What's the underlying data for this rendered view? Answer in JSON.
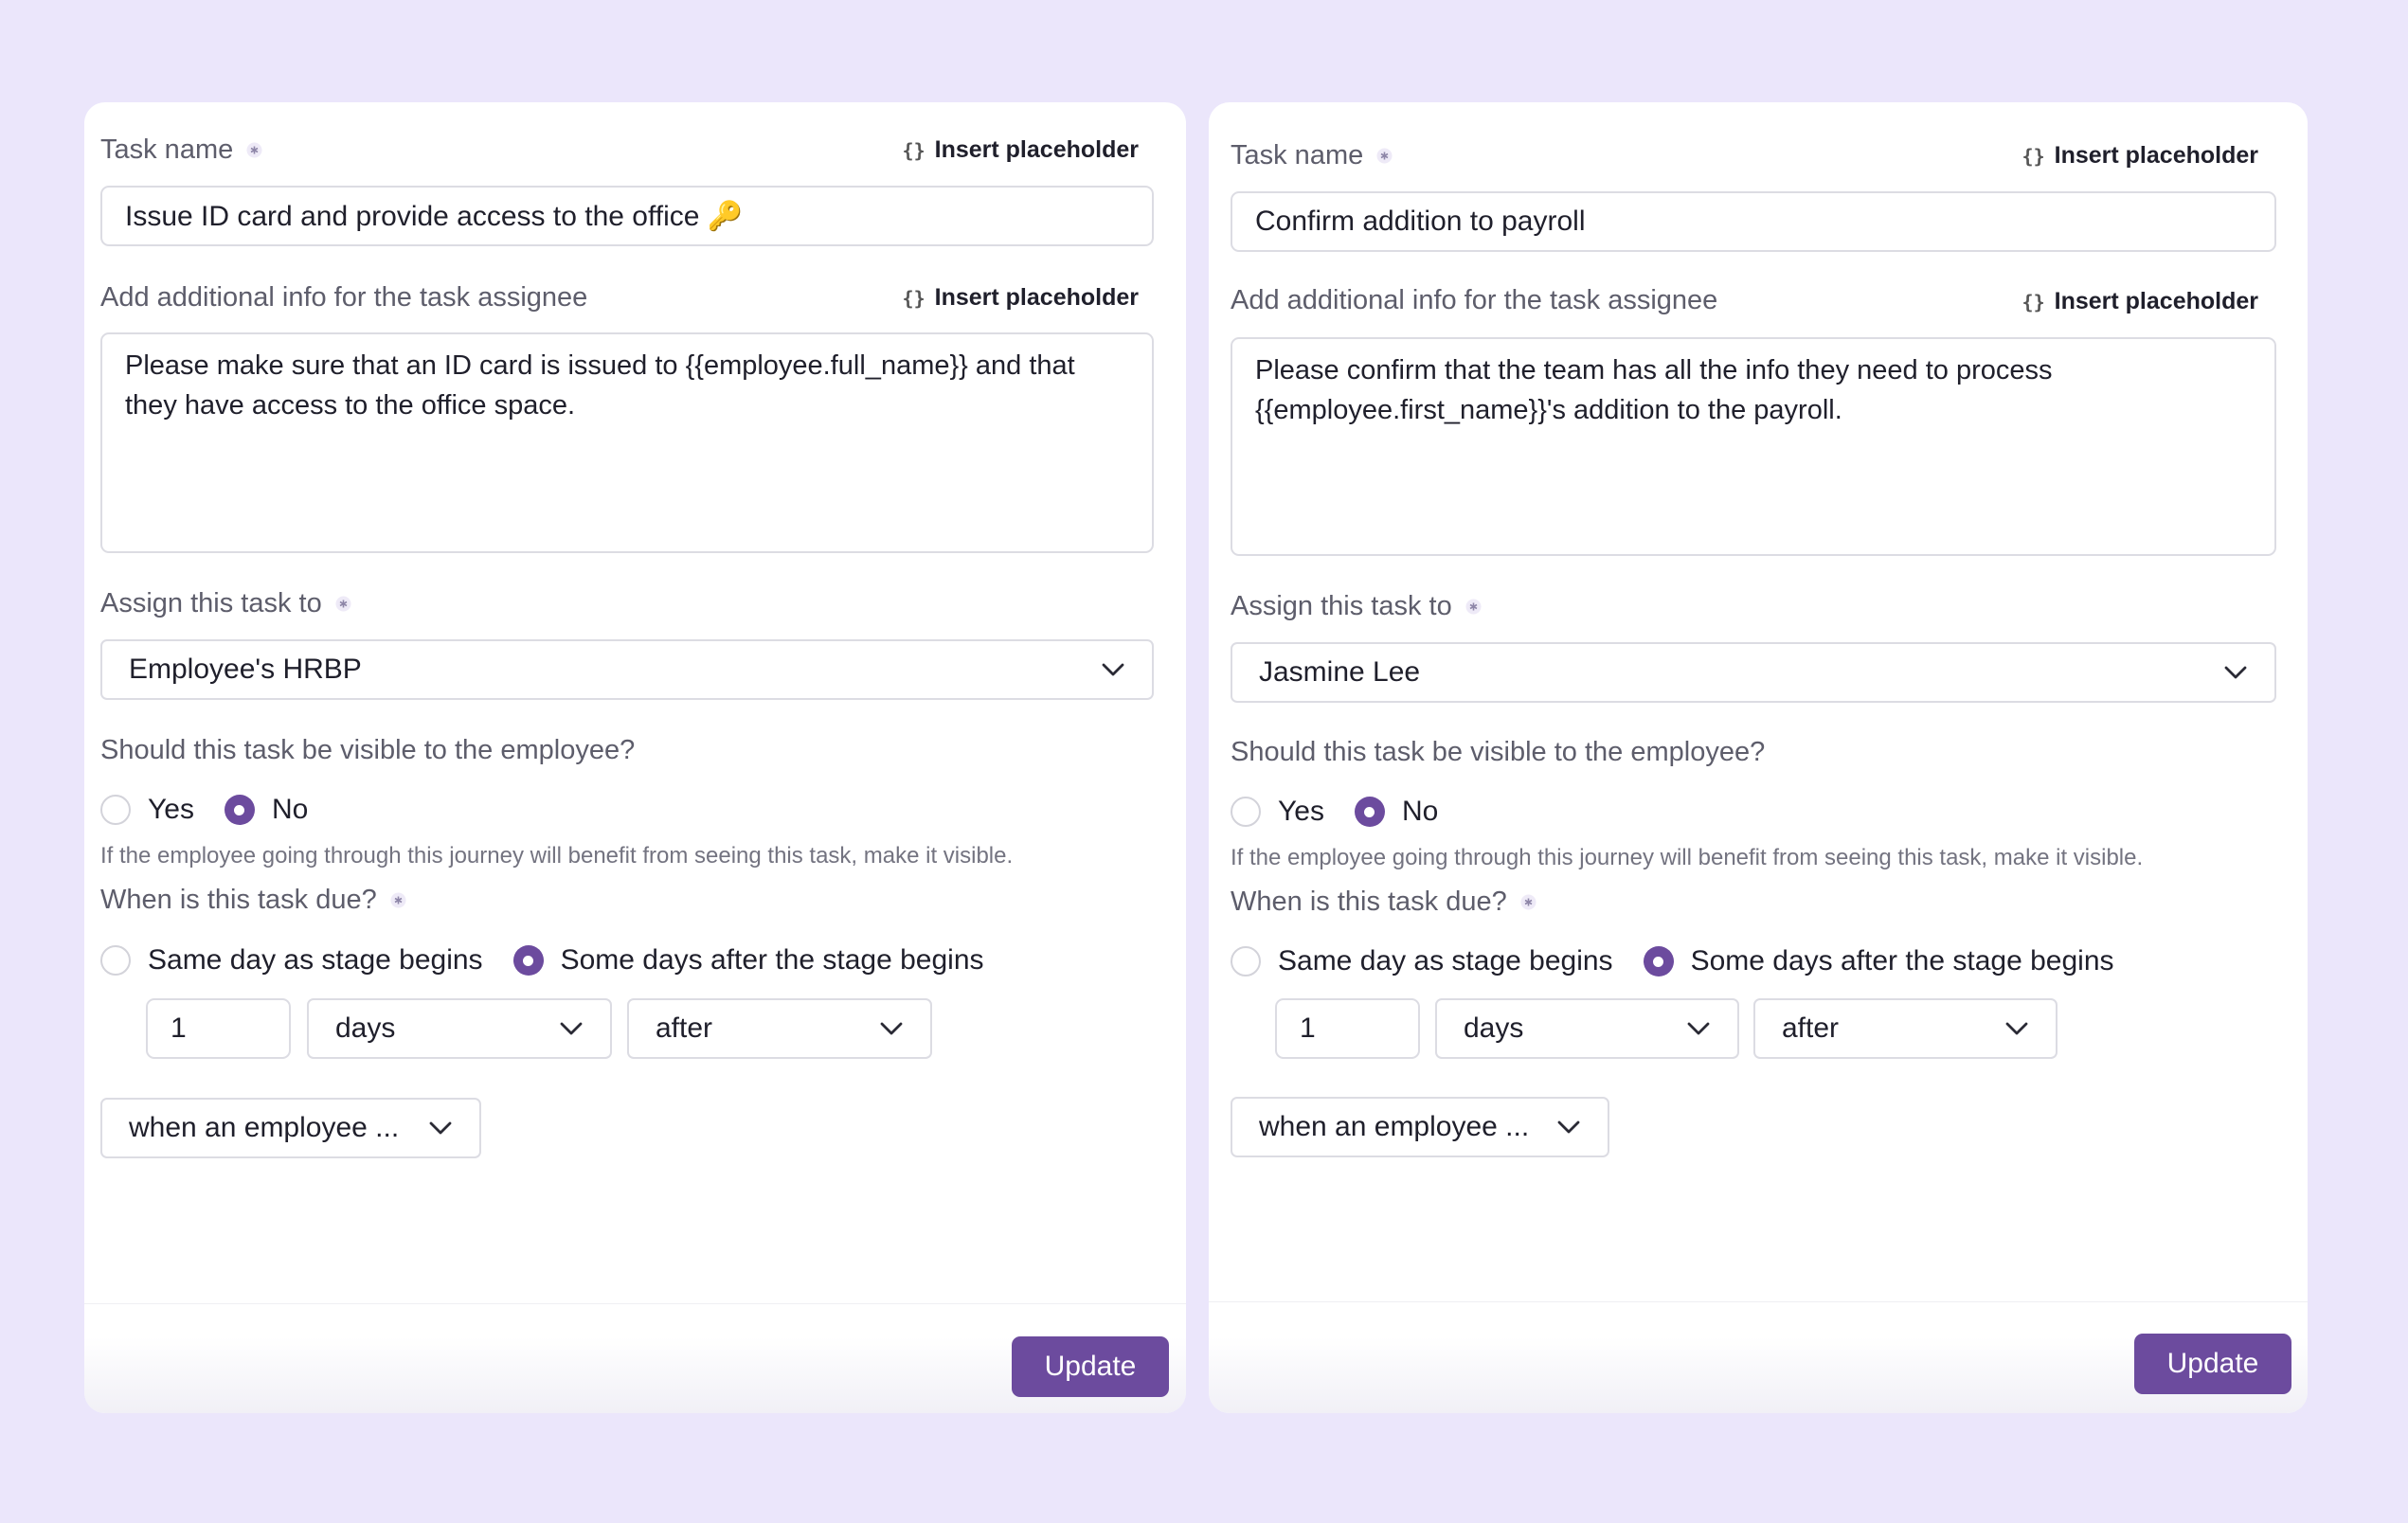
{
  "colors": {
    "background": "#ebe6fb",
    "accent": "#6c4b9e"
  },
  "left": {
    "task_name_label": "Task name",
    "insert_placeholder": "Insert placeholder",
    "task_name_value": "Issue ID card and provide access to the office 🔑",
    "info_label": "Add additional info for the task assignee",
    "info_value": "Please make sure that an ID card is issued to {{employee.full_name}} and that they have access to the office space.",
    "assign_label": "Assign this task to",
    "assign_value": "Employee's HRBP",
    "visible_label": "Should this task be visible to the employee?",
    "visible_yes": "Yes",
    "visible_no": "No",
    "visible_selected": "No",
    "visible_hint": "If the employee going through this journey will benefit from seeing this task, make it visible.",
    "due_label": "When is this task due?",
    "due_same_day": "Same day as stage begins",
    "due_some_days": "Some days after the stage begins",
    "due_selected": "Some days after the stage begins",
    "due_count": "1",
    "due_unit": "days",
    "due_relation": "after",
    "due_trigger": "when an employee ...",
    "update": "Update"
  },
  "right": {
    "task_name_label": "Task name",
    "insert_placeholder": "Insert placeholder",
    "task_name_value": "Confirm addition to payroll",
    "info_label": "Add additional info for the task assignee",
    "info_value": "Please confirm that the team has all the info they need to process {{employee.first_name}}'s addition to the payroll.",
    "assign_label": "Assign this task to",
    "assign_value": "Jasmine Lee",
    "visible_label": "Should this task be visible to the employee?",
    "visible_yes": "Yes",
    "visible_no": "No",
    "visible_selected": "No",
    "visible_hint": "If the employee going through this journey will benefit from seeing this task, make it visible.",
    "due_label": "When is this task due?",
    "due_same_day": "Same day as stage begins",
    "due_some_days": "Some days after the stage begins",
    "due_selected": "Some days after the stage begins",
    "due_count": "1",
    "due_unit": "days",
    "due_relation": "after",
    "due_trigger": "when an employee ...",
    "update": "Update"
  },
  "icons": {
    "required": "asterisk-icon",
    "placeholder": "curly-braces-icon",
    "dropdown": "chevron-down-icon"
  }
}
